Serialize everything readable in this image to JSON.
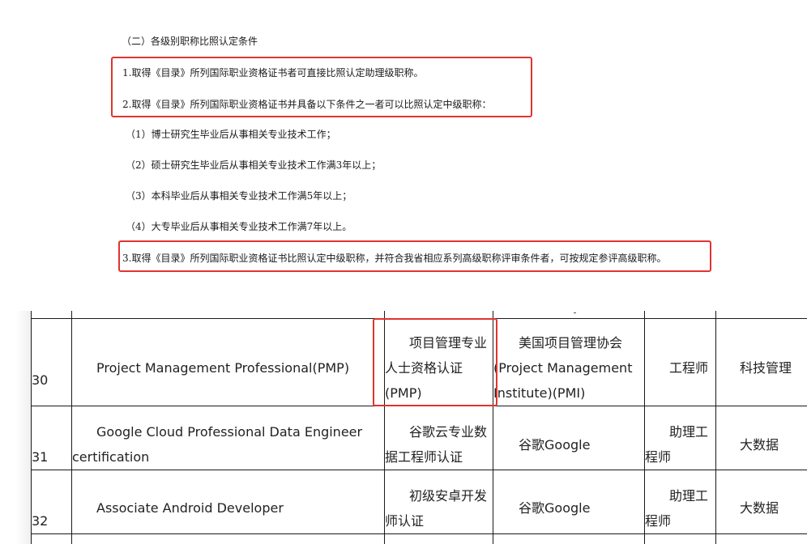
{
  "policy": {
    "heading": "（二）各级别职称比照认定条件",
    "item1": "1.取得《目录》所列国际职业资格证书者可直接比照认定助理级职称。",
    "item2": "2.取得《目录》所列国际职业资格证书并具备以下条件之一者可以比照认定中级职称：",
    "sub1": "（1）博士研究生毕业后从事相关专业技术工作；",
    "sub2": "（2）硕士研究生毕业后从事相关专业技术工作满3年以上；",
    "sub3": "（3）本科毕业后从事相关专业技术工作满5年以上；",
    "sub4": "（4）大专毕业后从事相关专业技术工作满7年以上。",
    "item3": "3.取得《目录》所列国际职业资格证书比照认定中级职称，并符合我省相应系列高级职称评审条件者，可按规定参评高级职称。"
  },
  "highlight_color": "#e0342f",
  "table": {
    "rows": [
      {
        "no": "30",
        "name_lines": [
          "Project Management Professional(PMP)"
        ],
        "cn_lines": [
          "项目管理专业",
          "人士资格认证",
          "(PMP)"
        ],
        "org_lines": [
          "美国项目管理协会",
          "(Project Management",
          "Institute)(PMI)"
        ],
        "title_lines": [
          "工程师"
        ],
        "field": "科技管理"
      },
      {
        "no": "31",
        "name_lines": [
          "Google Cloud Professional Data Engineer",
          "certification"
        ],
        "cn_lines": [
          "谷歌云专业数",
          "据工程师认证"
        ],
        "org_lines": [
          "谷歌Google"
        ],
        "title_lines": [
          "助理工",
          "程师"
        ],
        "field": "大数据"
      },
      {
        "no": "32",
        "name_lines": [
          "Associate Android Developer"
        ],
        "cn_lines": [
          "初级安卓开发",
          "师认证"
        ],
        "org_lines": [
          "谷歌Google"
        ],
        "title_lines": [
          "助理工",
          "程师"
        ],
        "field": "大数据"
      }
    ]
  }
}
